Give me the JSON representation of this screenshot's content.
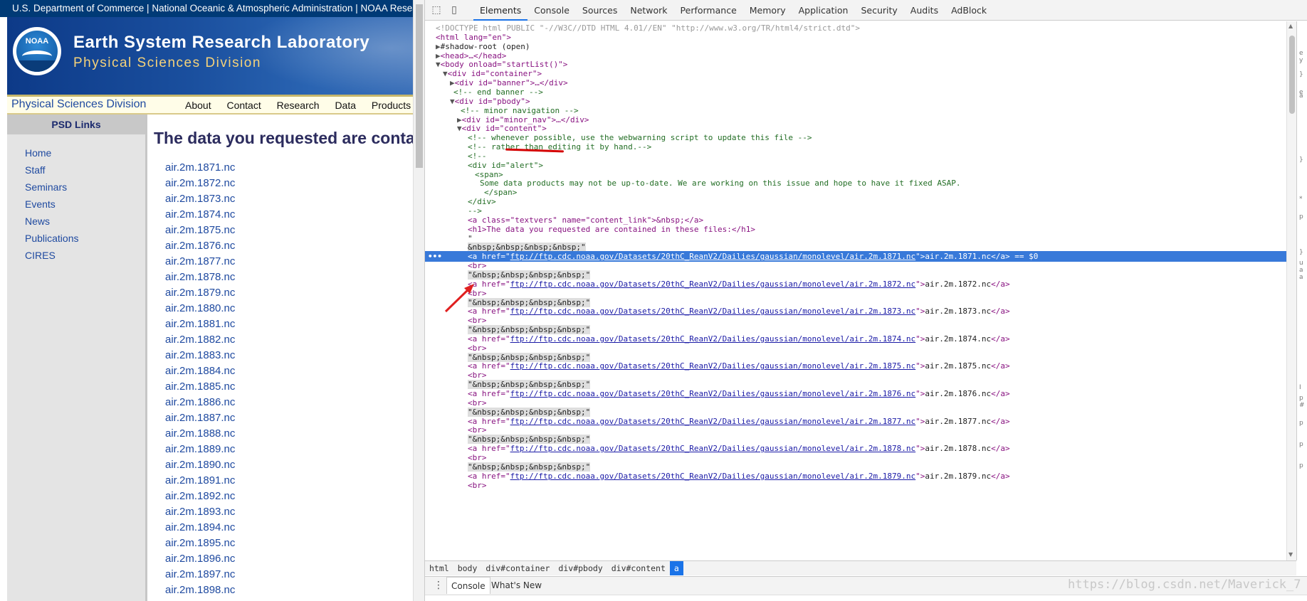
{
  "webpage": {
    "top_bar": "U.S. Department of Commerce | National Oceanic & Atmospheric Administration | NOAA Research",
    "logo_text": "NOAA",
    "banner_title": "Earth System Research Laboratory",
    "banner_subtitle": "Physical Sciences Division",
    "nav_brand": "Physical Sciences Division",
    "nav_links": [
      "About",
      "Contact",
      "Research",
      "Data",
      "Products"
    ],
    "sidebar_header": "PSD Links",
    "sidebar_links": [
      "Home",
      "Staff",
      "Seminars",
      "Events",
      "News",
      "Publications",
      "CIRES"
    ],
    "heading": "The data you requested are contained in these files:",
    "files": [
      "air.2m.1871.nc",
      "air.2m.1872.nc",
      "air.2m.1873.nc",
      "air.2m.1874.nc",
      "air.2m.1875.nc",
      "air.2m.1876.nc",
      "air.2m.1877.nc",
      "air.2m.1878.nc",
      "air.2m.1879.nc",
      "air.2m.1880.nc",
      "air.2m.1881.nc",
      "air.2m.1882.nc",
      "air.2m.1883.nc",
      "air.2m.1884.nc",
      "air.2m.1885.nc",
      "air.2m.1886.nc",
      "air.2m.1887.nc",
      "air.2m.1888.nc",
      "air.2m.1889.nc",
      "air.2m.1890.nc",
      "air.2m.1891.nc",
      "air.2m.1892.nc",
      "air.2m.1893.nc",
      "air.2m.1894.nc",
      "air.2m.1895.nc",
      "air.2m.1896.nc",
      "air.2m.1897.nc",
      "air.2m.1898.nc"
    ]
  },
  "devtools": {
    "inspect_icon": "⬚",
    "device_icon": "▯",
    "tabs": [
      "Elements",
      "Console",
      "Sources",
      "Network",
      "Performance",
      "Memory",
      "Application",
      "Security",
      "Audits",
      "AdBlock"
    ],
    "active_tab": "Elements",
    "dom": {
      "doctype": "<!DOCTYPE html PUBLIC \"-//W3C//DTD HTML 4.01//EN\" \"http://www.w3.org/TR/html4/strict.dtd\">",
      "html_open": "<html lang=\"en\">",
      "shadow_root": "#shadow-root (open)",
      "head": "<head>…</head>",
      "body_open": "<body onload=\"startList()\">",
      "div_container": "<div id=\"container\">",
      "div_banner": "<div id=\"banner\">…</div>",
      "end_banner": "<!-- end banner -->",
      "div_pbody": "<div id=\"pbody\">",
      "minor_nav_comment": "<!-- minor navigation -->",
      "div_minor_nav": "<div id=\"minor_nav\">…</div>",
      "div_content": "<div id=\"content\">",
      "c1": "<!-- whenever possible, use the webwarning script to update this file -->",
      "c2": "<!-- rather than editing it by hand.-->",
      "c3": "<!--",
      "c4": "<div id=\"alert\">",
      "c5": "<span>",
      "c6": "Some data products may not be up-to-date. We are working on this issue and hope to have it fixed ASAP.",
      "c7": "</span>",
      "c8": "</div>",
      "c9": "-->",
      "a_textvers": "<a class=\"textvers\" name=\"content_link\">&nbsp;</a>",
      "h1": "<h1>The data you requested are contained in these files:</h1>",
      "quote": "\"",
      "nbsp_line": "&nbsp;&nbsp;&nbsp;&nbsp;\"",
      "nbsp_text": "\"&nbsp;&nbsp;&nbsp;&nbsp;\"",
      "br": "<br>",
      "href_base": "ftp://ftp.cdc.noaa.gov/Datasets/20thC_ReanV2/Dailies/gaussian/monolevel/",
      "selected_suffix": "== $0",
      "link_files": [
        "air.2m.1871.nc",
        "air.2m.1872.nc",
        "air.2m.1873.nc",
        "air.2m.1874.nc",
        "air.2m.1875.nc",
        "air.2m.1876.nc",
        "air.2m.1877.nc",
        "air.2m.1878.nc",
        "air.2m.1879.nc"
      ]
    },
    "breadcrumbs": [
      "html",
      "body",
      "div#container",
      "div#pbody",
      "div#content",
      "a"
    ],
    "drawer_tabs": [
      "Console",
      "What's New"
    ],
    "drawer_menu_icon": "⋮",
    "side_pane_chars": [
      "e",
      "y",
      "}",
      "e",
      "a",
      "}",
      "*",
      "p",
      "}",
      "u",
      "a",
      "a",
      "I",
      "p",
      "#",
      "p",
      "p",
      "p"
    ]
  },
  "watermark": "https://blog.csdn.net/Maverick_7"
}
